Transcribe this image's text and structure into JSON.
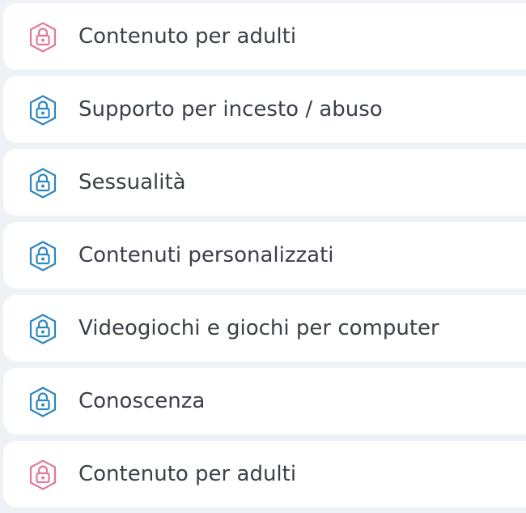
{
  "categories": [
    {
      "label": "Contenuto per adulti",
      "icon": "lock-icon",
      "color": "#e07a9a"
    },
    {
      "label": "Supporto per incesto / abuso",
      "icon": "lock-icon",
      "color": "#2e86c1"
    },
    {
      "label": "Sessualità",
      "icon": "lock-icon",
      "color": "#2e86c1"
    },
    {
      "label": "Contenuti personalizzati",
      "icon": "lock-icon",
      "color": "#2e86c1"
    },
    {
      "label": "Videogiochi e giochi per computer",
      "icon": "lock-icon",
      "color": "#2e86c1"
    },
    {
      "label": "Conoscenza",
      "icon": "lock-icon",
      "color": "#2e86c1"
    },
    {
      "label": "Contenuto per adulti",
      "icon": "lock-icon",
      "color": "#e07a9a"
    }
  ]
}
